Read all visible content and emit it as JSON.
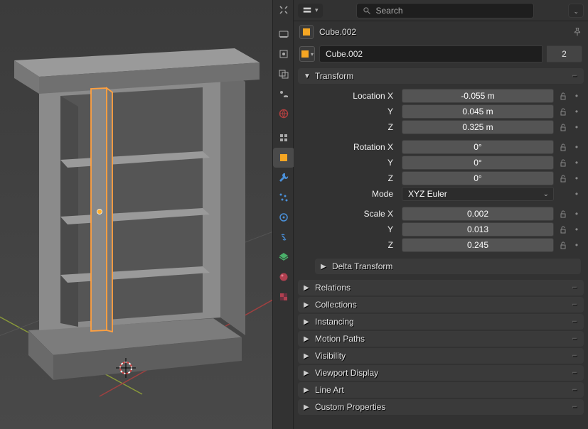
{
  "search_placeholder": "Search",
  "object_name": "Cube.002",
  "datablock_name": "Cube.002",
  "user_count": "2",
  "panels": {
    "transform": "Transform",
    "delta_transform": "Delta Transform",
    "relations": "Relations",
    "collections": "Collections",
    "instancing": "Instancing",
    "motion_paths": "Motion Paths",
    "visibility": "Visibility",
    "viewport_display": "Viewport Display",
    "line_art": "Line Art",
    "custom_properties": "Custom Properties"
  },
  "labels": {
    "location_x": "Location X",
    "rotation_x": "Rotation X",
    "scale_x": "Scale X",
    "y": "Y",
    "z": "Z",
    "mode": "Mode"
  },
  "values": {
    "loc_x": "-0.055 m",
    "loc_y": "0.045 m",
    "loc_z": "0.325 m",
    "rot_x": "0°",
    "rot_y": "0°",
    "rot_z": "0°",
    "rot_mode": "XYZ Euler",
    "scale_x": "0.002",
    "scale_y": "0.013",
    "scale_z": "0.245"
  }
}
